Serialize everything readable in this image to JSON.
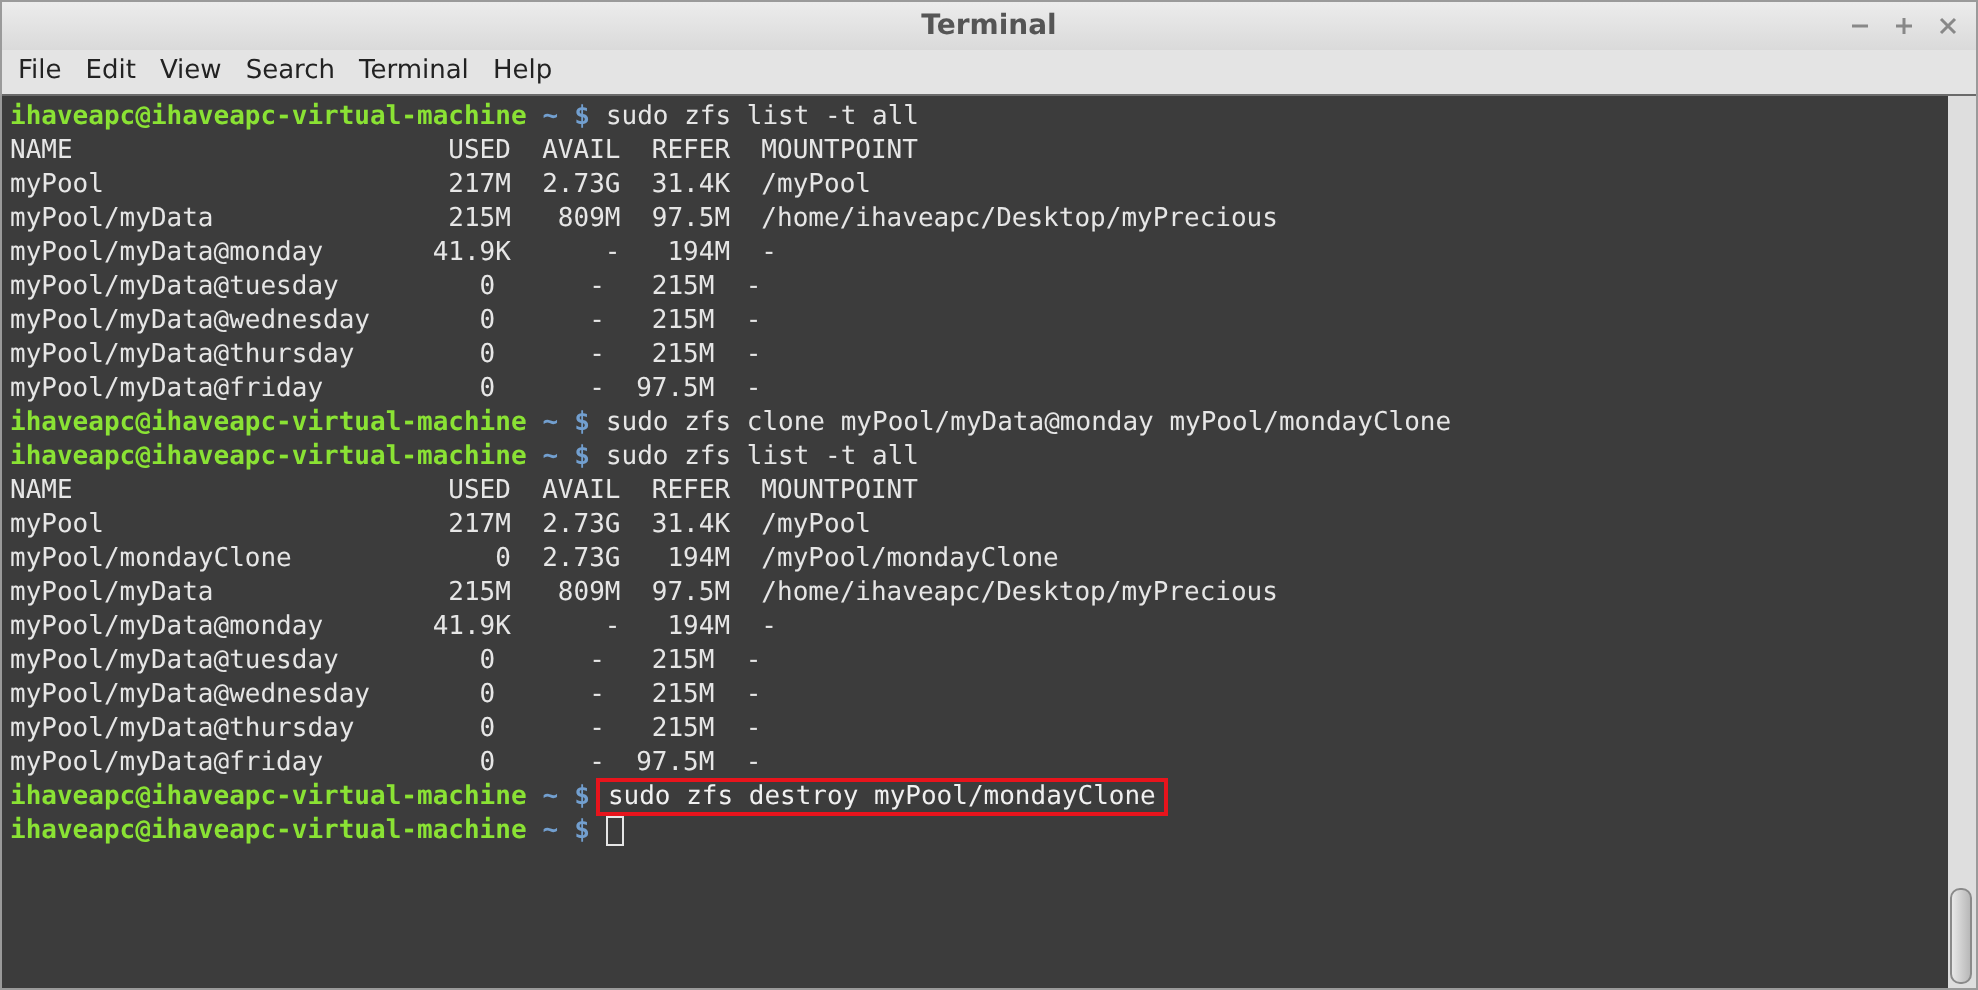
{
  "window": {
    "title": "Terminal"
  },
  "menu": [
    "File",
    "Edit",
    "View",
    "Search",
    "Terminal",
    "Help"
  ],
  "terminal": {
    "lines": [
      {
        "kind": "prompt",
        "user_host": "ihaveapc@ihaveapc-virtual-machine",
        "path": "~",
        "symbol": "$",
        "command": "sudo zfs list -t all"
      },
      {
        "kind": "output",
        "text": "NAME                        USED  AVAIL  REFER  MOUNTPOINT"
      },
      {
        "kind": "output",
        "text": "myPool                      217M  2.73G  31.4K  /myPool"
      },
      {
        "kind": "output",
        "text": "myPool/myData               215M   809M  97.5M  /home/ihaveapc/Desktop/myPrecious"
      },
      {
        "kind": "output",
        "text": "myPool/myData@monday       41.9K      -   194M  -"
      },
      {
        "kind": "output",
        "text": "myPool/myData@tuesday         0      -   215M  -"
      },
      {
        "kind": "output",
        "text": "myPool/myData@wednesday       0      -   215M  -"
      },
      {
        "kind": "output",
        "text": "myPool/myData@thursday        0      -   215M  -"
      },
      {
        "kind": "output",
        "text": "myPool/myData@friday          0      -  97.5M  -"
      },
      {
        "kind": "prompt",
        "user_host": "ihaveapc@ihaveapc-virtual-machine",
        "path": "~",
        "symbol": "$",
        "command": "sudo zfs clone myPool/myData@monday myPool/mondayClone"
      },
      {
        "kind": "prompt",
        "user_host": "ihaveapc@ihaveapc-virtual-machine",
        "path": "~",
        "symbol": "$",
        "command": "sudo zfs list -t all"
      },
      {
        "kind": "output",
        "text": "NAME                        USED  AVAIL  REFER  MOUNTPOINT"
      },
      {
        "kind": "output",
        "text": "myPool                      217M  2.73G  31.4K  /myPool"
      },
      {
        "kind": "output",
        "text": "myPool/mondayClone             0  2.73G   194M  /myPool/mondayClone"
      },
      {
        "kind": "output",
        "text": "myPool/myData               215M   809M  97.5M  /home/ihaveapc/Desktop/myPrecious"
      },
      {
        "kind": "output",
        "text": "myPool/myData@monday       41.9K      -   194M  -"
      },
      {
        "kind": "output",
        "text": "myPool/myData@tuesday         0      -   215M  -"
      },
      {
        "kind": "output",
        "text": "myPool/myData@wednesday       0      -   215M  -"
      },
      {
        "kind": "output",
        "text": "myPool/myData@thursday        0      -   215M  -"
      },
      {
        "kind": "output",
        "text": "myPool/myData@friday          0      -  97.5M  -"
      },
      {
        "kind": "prompt",
        "user_host": "ihaveapc@ihaveapc-virtual-machine",
        "path": "~",
        "symbol": "$",
        "command": "sudo zfs destroy myPool/mondayClone",
        "highlighted": true
      },
      {
        "kind": "prompt",
        "user_host": "ihaveapc@ihaveapc-virtual-machine",
        "path": "~",
        "symbol": "$",
        "cursor": true
      }
    ]
  }
}
